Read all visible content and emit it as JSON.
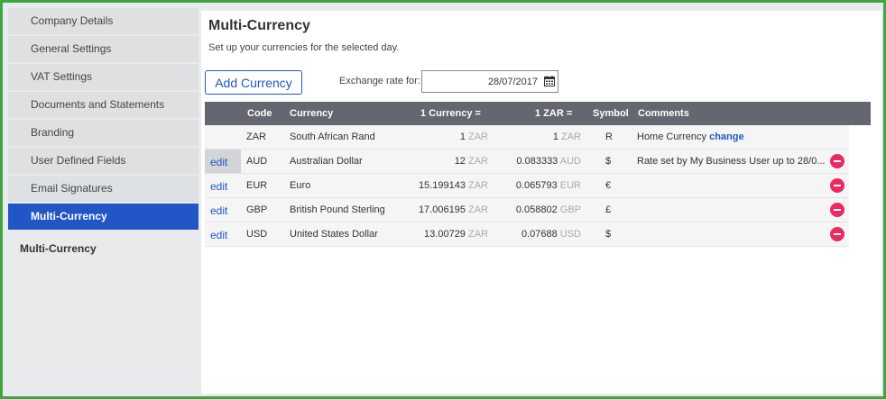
{
  "sidebar": {
    "items": [
      {
        "label": "Company Details"
      },
      {
        "label": "General Settings"
      },
      {
        "label": "VAT Settings"
      },
      {
        "label": "Documents and Statements"
      },
      {
        "label": "Branding"
      },
      {
        "label": "User Defined Fields"
      },
      {
        "label": "Email Signatures"
      },
      {
        "label": "Multi-Currency",
        "active": true
      }
    ],
    "section_heading": "Multi-Currency"
  },
  "main": {
    "title": "Multi-Currency",
    "subtitle": "Set up your currencies for the selected day.",
    "add_button": "Add Currency",
    "exchange_rate_label": "Exchange rate for:",
    "exchange_rate_date": "28/07/2017"
  },
  "table": {
    "columns": [
      "Code",
      "Currency",
      "1 Currency =",
      "1 ZAR =",
      "Symbol",
      "Comments"
    ],
    "edit_label": "edit",
    "rows": [
      {
        "code": "ZAR",
        "currency": "South African Rand",
        "one_currency": "1",
        "one_currency_unit": "ZAR",
        "one_zar": "1",
        "one_zar_unit": "ZAR",
        "symbol": "R",
        "comment": "Home Currency",
        "comment_link": "change"
      },
      {
        "code": "AUD",
        "currency": "Australian Dollar",
        "one_currency": "12",
        "one_currency_unit": "ZAR",
        "one_zar": "0.083333",
        "one_zar_unit": "AUD",
        "symbol": "$",
        "comment": "Rate set by My Business User up to 28/0..."
      },
      {
        "code": "EUR",
        "currency": "Euro",
        "one_currency": "15.199143",
        "one_currency_unit": "ZAR",
        "one_zar": "0.065793",
        "one_zar_unit": "EUR",
        "symbol": "€",
        "comment": ""
      },
      {
        "code": "GBP",
        "currency": "British Pound Sterling",
        "one_currency": "17.006195",
        "one_currency_unit": "ZAR",
        "one_zar": "0.058802",
        "one_zar_unit": "GBP",
        "symbol": "£",
        "comment": ""
      },
      {
        "code": "USD",
        "currency": "United States Dollar",
        "one_currency": "13.00729",
        "one_currency_unit": "ZAR",
        "one_zar": "0.07688",
        "one_zar_unit": "USD",
        "symbol": "$",
        "comment": ""
      }
    ]
  },
  "colors": {
    "accent": "#2256c6",
    "frame": "#3fa540",
    "header": "#646670",
    "remove": "#ea2a61"
  }
}
